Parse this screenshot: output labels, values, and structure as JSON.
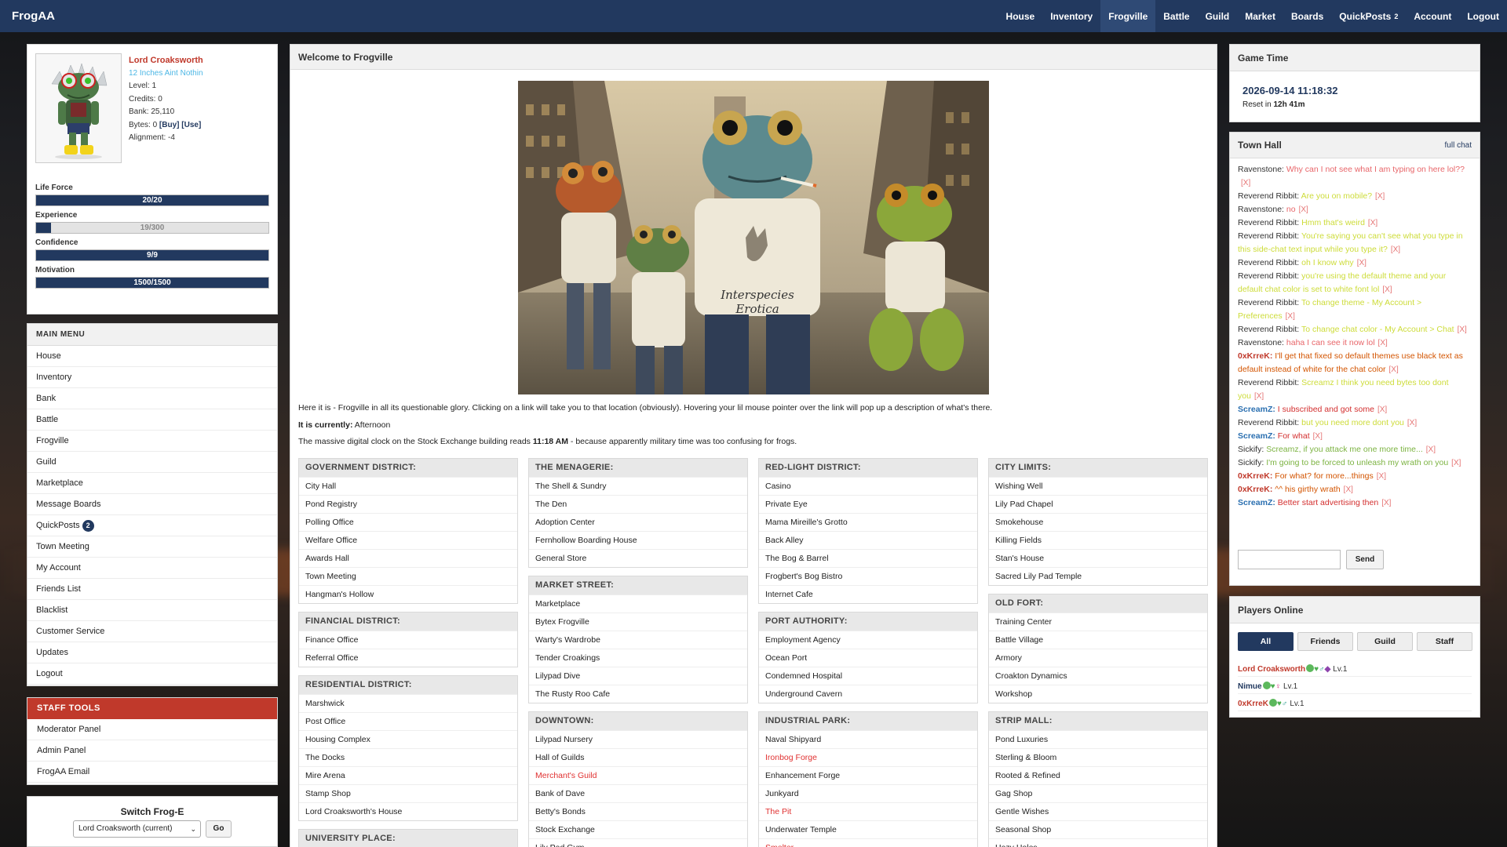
{
  "brand": "FrogAA",
  "nav": [
    {
      "label": "House",
      "active": false
    },
    {
      "label": "Inventory",
      "active": false
    },
    {
      "label": "Frogville",
      "active": true
    },
    {
      "label": "Battle",
      "active": false
    },
    {
      "label": "Guild",
      "active": false
    },
    {
      "label": "Market",
      "active": false
    },
    {
      "label": "Boards",
      "active": false
    },
    {
      "label": "QuickPosts",
      "count": "2",
      "active": false
    },
    {
      "label": "Account",
      "active": false
    },
    {
      "label": "Logout",
      "active": false
    }
  ],
  "profile": {
    "name": "Lord Croaksworth",
    "title": "12 Inches Aint Nothin",
    "level": "Level: 1",
    "credits": "Credits: 0",
    "bank": "Bank: 25,110",
    "bytes_prefix": "Bytes: 0",
    "buy": "[Buy]",
    "use": "[Use]",
    "alignment": "Alignment: -4"
  },
  "stats": [
    {
      "label": "Life Force",
      "text": "20/20",
      "fraction": 1.0
    },
    {
      "label": "Experience",
      "text": "19/300",
      "fraction": 0.063
    },
    {
      "label": "Confidence",
      "text": "9/9",
      "fraction": 1.0
    },
    {
      "label": "Motivation",
      "text": "1500/1500",
      "fraction": 1.0
    }
  ],
  "main_menu": {
    "title": "MAIN MENU",
    "items": [
      {
        "label": "House"
      },
      {
        "label": "Inventory"
      },
      {
        "label": "Bank"
      },
      {
        "label": "Battle"
      },
      {
        "label": "Frogville"
      },
      {
        "label": "Guild"
      },
      {
        "label": "Marketplace"
      },
      {
        "label": "Message Boards"
      },
      {
        "label": "QuickPosts",
        "badge": "2"
      },
      {
        "label": "Town Meeting"
      },
      {
        "label": "My Account"
      },
      {
        "label": "Friends List"
      },
      {
        "label": "Blacklist"
      },
      {
        "label": "Customer Service"
      },
      {
        "label": "Updates"
      },
      {
        "label": "Logout"
      }
    ]
  },
  "staff_tools": {
    "title": "STAFF TOOLS",
    "items": [
      {
        "label": "Moderator Panel"
      },
      {
        "label": "Admin Panel"
      },
      {
        "label": "FrogAA Email"
      }
    ]
  },
  "switch_frog": {
    "title": "Switch Frog-E",
    "selected": "Lord Croaksworth (current)",
    "go": "Go"
  },
  "center": {
    "title": "Welcome to Frogville",
    "tshirt_text_1": "Interspecies",
    "tshirt_text_2": "Erotica",
    "intro": "Here it is - Frogville in all its questionable glory. Clicking on a link will take you to that location (obviously). Hovering your lil mouse pointer over the link will pop up a description of what's there.",
    "currently_label": "It is currently:",
    "currently_value": "Afternoon",
    "clock_pre": "The massive digital clock on the Stock Exchange building reads",
    "clock_time": "11:18 AM",
    "clock_post": "- because apparently military time was too confusing for frogs."
  },
  "districts": [
    {
      "title": "GOVERNMENT DISTRICT:",
      "items": [
        {
          "label": "City Hall"
        },
        {
          "label": "Pond Registry"
        },
        {
          "label": "Polling Office"
        },
        {
          "label": "Welfare Office"
        },
        {
          "label": "Awards Hall"
        },
        {
          "label": "Town Meeting"
        },
        {
          "label": "Hangman's Hollow"
        }
      ]
    },
    {
      "title": "FINANCIAL DISTRICT:",
      "items": [
        {
          "label": "Finance Office"
        },
        {
          "label": "Referral Office"
        }
      ]
    },
    {
      "title": "RESIDENTIAL DISTRICT:",
      "items": [
        {
          "label": "Marshwick"
        },
        {
          "label": "Post Office"
        },
        {
          "label": "Housing Complex"
        },
        {
          "label": "The Docks"
        },
        {
          "label": "Mire Arena"
        },
        {
          "label": "Stamp Shop"
        },
        {
          "label": "Lord Croaksworth's House"
        }
      ]
    },
    {
      "title": "UNIVERSITY PLACE:",
      "items": []
    },
    {
      "title": "THE MENAGERIE:",
      "items": [
        {
          "label": "The Shell & Sundry"
        },
        {
          "label": "The Den"
        },
        {
          "label": "Adoption Center"
        },
        {
          "label": "Fernhollow Boarding House"
        },
        {
          "label": "General Store"
        }
      ]
    },
    {
      "title": "MARKET STREET:",
      "items": [
        {
          "label": "Marketplace"
        },
        {
          "label": "Bytex Frogville"
        },
        {
          "label": "Warty's Wardrobe"
        },
        {
          "label": "Tender Croakings"
        },
        {
          "label": "Lilypad Dive"
        },
        {
          "label": "The Rusty Roo Cafe"
        }
      ]
    },
    {
      "title": "DOWNTOWN:",
      "items": [
        {
          "label": "Lilypad Nursery"
        },
        {
          "label": "Hall of Guilds"
        },
        {
          "label": "Merchant's Guild",
          "red": true
        },
        {
          "label": "Bank of Dave"
        },
        {
          "label": "Betty's Bonds"
        },
        {
          "label": "Stock Exchange"
        },
        {
          "label": "Lily Pad Gym"
        }
      ]
    },
    {
      "title": "RED-LIGHT DISTRICT:",
      "items": [
        {
          "label": "Casino"
        },
        {
          "label": "Private Eye"
        },
        {
          "label": "Mama Mireille's Grotto"
        },
        {
          "label": "Back Alley"
        },
        {
          "label": "The Bog & Barrel"
        },
        {
          "label": "Frogbert's Bog Bistro"
        },
        {
          "label": "Internet Cafe"
        }
      ]
    },
    {
      "title": "PORT AUTHORITY:",
      "items": [
        {
          "label": "Employment Agency"
        },
        {
          "label": "Ocean Port"
        },
        {
          "label": "Condemned Hospital"
        },
        {
          "label": "Underground Cavern"
        }
      ]
    },
    {
      "title": "INDUSTRIAL PARK:",
      "items": [
        {
          "label": "Naval Shipyard"
        },
        {
          "label": "Ironbog Forge",
          "red": true
        },
        {
          "label": "Enhancement Forge"
        },
        {
          "label": "Junkyard"
        },
        {
          "label": "The Pit",
          "red": true
        },
        {
          "label": "Underwater Temple"
        },
        {
          "label": "Smelter",
          "red": true
        }
      ]
    },
    {
      "title": "CITY LIMITS:",
      "items": [
        {
          "label": "Wishing Well"
        },
        {
          "label": "Lily Pad Chapel"
        },
        {
          "label": "Smokehouse"
        },
        {
          "label": "Killing Fields"
        },
        {
          "label": "Stan's House"
        },
        {
          "label": "Sacred Lily Pad Temple"
        }
      ]
    },
    {
      "title": "OLD FORT:",
      "items": [
        {
          "label": "Training Center"
        },
        {
          "label": "Battle Village"
        },
        {
          "label": "Armory"
        },
        {
          "label": "Croakton Dynamics"
        },
        {
          "label": "Workshop"
        }
      ]
    },
    {
      "title": "STRIP MALL:",
      "items": [
        {
          "label": "Pond Luxuries"
        },
        {
          "label": "Sterling & Bloom"
        },
        {
          "label": "Rooted & Refined"
        },
        {
          "label": "Gag Shop"
        },
        {
          "label": "Gentle Wishes"
        },
        {
          "label": "Seasonal Shop"
        },
        {
          "label": "Hazy Holes"
        }
      ]
    }
  ],
  "game_time": {
    "title": "Game Time",
    "datetime": "2026-09-14 11:18:32",
    "reset_label": "Reset in",
    "reset_value": "12h 41m"
  },
  "town_hall": {
    "title": "Town Hall",
    "full_chat": "full chat",
    "send": "Send",
    "input_value": "",
    "close_mark": "[X]",
    "messages": [
      {
        "user": "Ravenstone:",
        "text": "Why can I not see what I am typing on here lol??",
        "user_color": "#333333",
        "text_color": "#e8666a"
      },
      {
        "user": "Reverend Ribbit:",
        "text": "Are you on mobile?",
        "user_color": "#333333",
        "text_color": "#cddc39"
      },
      {
        "user": "Ravenstone:",
        "text": "no",
        "user_color": "#333333",
        "text_color": "#e8666a"
      },
      {
        "user": "Reverend Ribbit:",
        "text": "Hmm that's weird",
        "user_color": "#333333",
        "text_color": "#cddc39"
      },
      {
        "user": "Reverend Ribbit:",
        "text": "You're saying you can't see what you type in this side-chat text input while you type it?",
        "user_color": "#333333",
        "text_color": "#cddc39"
      },
      {
        "user": "Reverend Ribbit:",
        "text": "oh I know why",
        "user_color": "#333333",
        "text_color": "#cddc39"
      },
      {
        "user": "Reverend Ribbit:",
        "text": "you're using the default theme and your default chat color is set to white font lol",
        "user_color": "#333333",
        "text_color": "#cddc39"
      },
      {
        "user": "Reverend Ribbit:",
        "text": "To change theme - My Account > Preferences",
        "user_color": "#333333",
        "text_color": "#cddc39"
      },
      {
        "user": "Reverend Ribbit:",
        "text": "To change chat color - My Account > Chat",
        "user_color": "#333333",
        "text_color": "#cddc39"
      },
      {
        "user": "Ravenstone:",
        "text": "haha I can see it now lol",
        "user_color": "#333333",
        "text_color": "#e8666a"
      },
      {
        "user": "0xKrreK:",
        "text": "I'll get that fixed so default themes use black text as default instead of white for the chat color",
        "user_color": "#c0392b",
        "text_color": "#d35400"
      },
      {
        "user": "Reverend Ribbit:",
        "text": "Screamz I think you need bytes too dont you",
        "user_color": "#333333",
        "text_color": "#cddc39"
      },
      {
        "user": "ScreamZ:",
        "text": "I subscribed and got some",
        "user_color": "#2a6fb0",
        "text_color": "#d32f2f"
      },
      {
        "user": "Reverend Ribbit:",
        "text": "but you need more dont you",
        "user_color": "#333333",
        "text_color": "#cddc39"
      },
      {
        "user": "ScreamZ:",
        "text": "For what",
        "user_color": "#2a6fb0",
        "text_color": "#d32f2f"
      },
      {
        "user": "Sickify:",
        "text": "Screamz, if you attack me one more time...",
        "user_color": "#333333",
        "text_color": "#7cb342"
      },
      {
        "user": "Sickify:",
        "text": "I'm going to be forced to unleash my wrath on you",
        "user_color": "#333333",
        "text_color": "#7cb342"
      },
      {
        "user": "0xKrreK:",
        "text": "For what? for more...things",
        "user_color": "#c0392b",
        "text_color": "#d35400"
      },
      {
        "user": "0xKrreK:",
        "text": "^^ his girthy wrath",
        "user_color": "#c0392b",
        "text_color": "#d35400"
      },
      {
        "user": "ScreamZ:",
        "text": "Better start advertising then",
        "user_color": "#2a6fb0",
        "text_color": "#d32f2f"
      }
    ]
  },
  "players_online": {
    "title": "Players Online",
    "filters": [
      {
        "label": "All",
        "active": true
      },
      {
        "label": "Friends"
      },
      {
        "label": "Guild"
      },
      {
        "label": "Staff"
      }
    ],
    "players": [
      {
        "name": "Lord Croaksworth",
        "level": "Lv.1",
        "color": "#c0392b",
        "icons": [
          "dot-green",
          "heart-green",
          "male",
          "devil"
        ]
      },
      {
        "name": "Nimue",
        "level": "Lv.1",
        "color": "#22395f",
        "icons": [
          "dot-green",
          "heart-green",
          "female"
        ]
      },
      {
        "name": "0xKrreK",
        "level": "Lv.1",
        "color": "#c0392b",
        "icons": [
          "dot-green",
          "heart-green",
          "male"
        ]
      }
    ]
  }
}
